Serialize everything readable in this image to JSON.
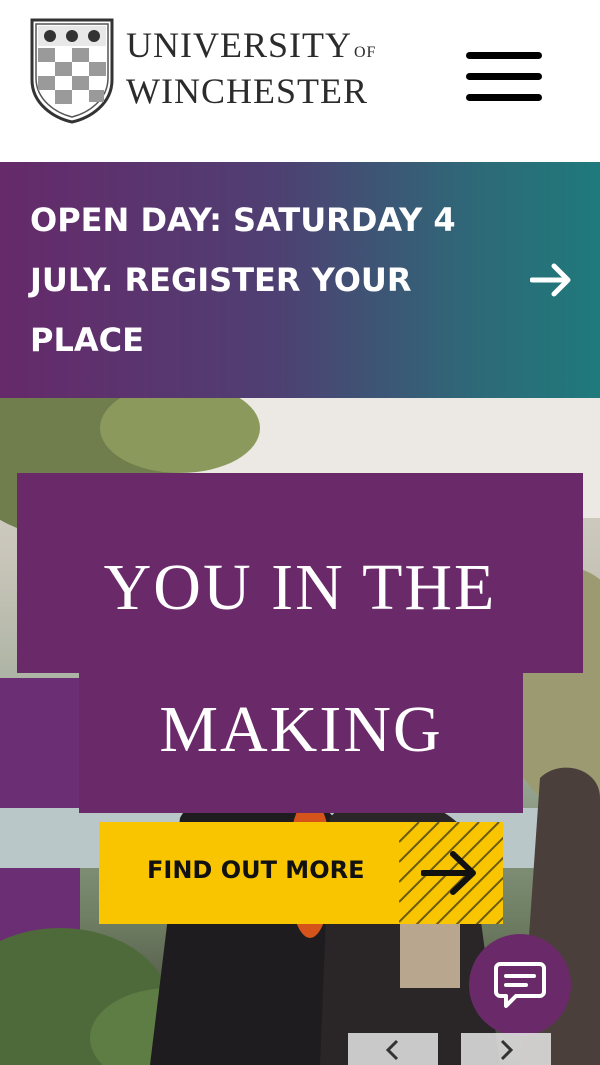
{
  "header": {
    "logo": {
      "line1": "UNIVERSITY",
      "of": "OF",
      "line2": "WINCHESTER"
    },
    "menu_icon": "hamburger-menu-icon"
  },
  "banner": {
    "text": "OPEN DAY: SATURDAY 4 JULY. REGISTER YOUR PLACE",
    "arrow_icon": "arrow-right-icon",
    "gradient": [
      "#66296a",
      "#1f7a7c"
    ]
  },
  "hero": {
    "title_line1": "YOU IN THE",
    "title_line2": "MAKING",
    "cta_label": "FIND OUT MORE",
    "cta_icon": "arrow-right-icon",
    "chat_icon": "chat-bubble-icon",
    "slider_prev_icon": "chevron-left-icon",
    "slider_next_icon": "chevron-right-icon"
  },
  "colors": {
    "brand_purple": "#6a2a69",
    "cta_yellow": "#f8c500",
    "banner_teal": "#1f7a7c"
  }
}
